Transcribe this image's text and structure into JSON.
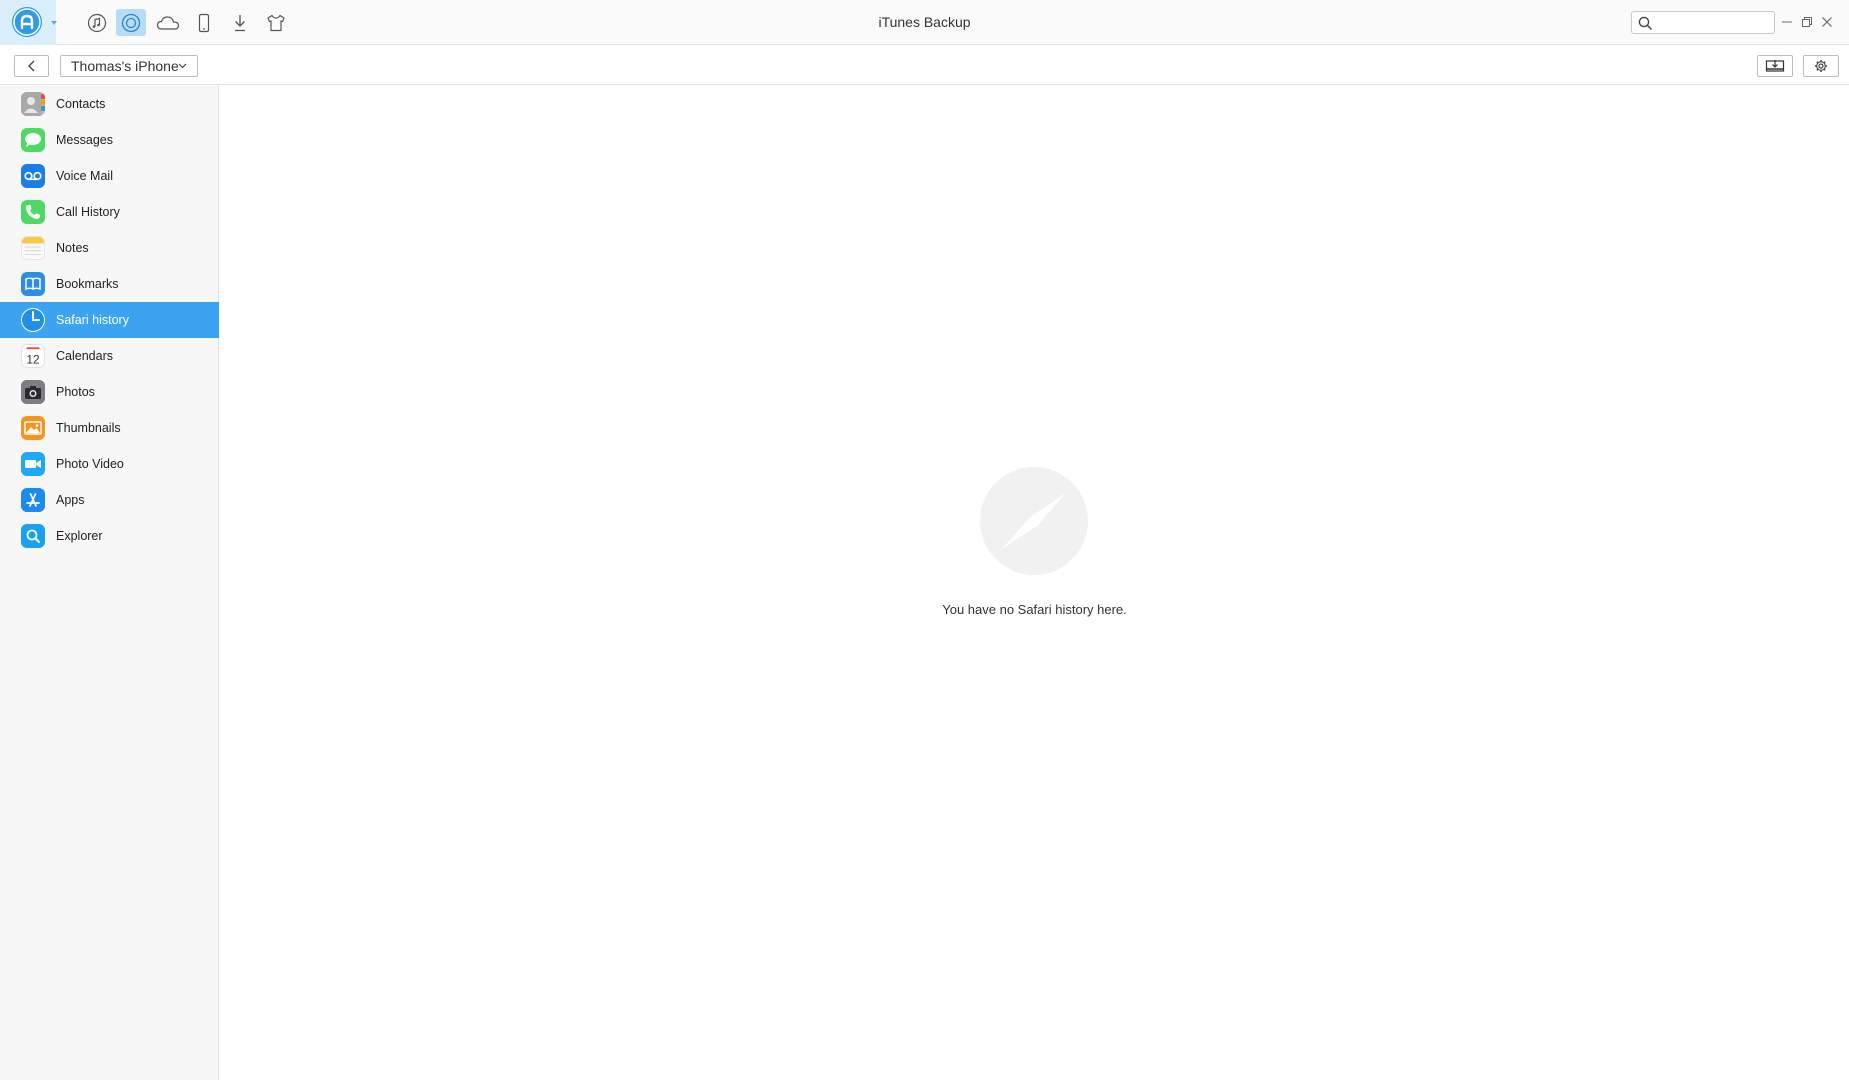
{
  "window": {
    "title": "iTunes Backup"
  },
  "top_icons": [
    {
      "name": "music-icon"
    },
    {
      "name": "itunes-backup-icon",
      "active": true
    },
    {
      "name": "icloud-icon"
    },
    {
      "name": "device-icon"
    },
    {
      "name": "download-icon"
    },
    {
      "name": "toolkit-icon"
    }
  ],
  "search": {
    "placeholder": "",
    "value": ""
  },
  "toolbar": {
    "device_name": "Thomas's iPhone"
  },
  "sidebar": {
    "items": [
      {
        "label": "Contacts",
        "icon": "contacts-icon"
      },
      {
        "label": "Messages",
        "icon": "messages-icon"
      },
      {
        "label": "Voice Mail",
        "icon": "voicemail-icon"
      },
      {
        "label": "Call History",
        "icon": "phone-icon"
      },
      {
        "label": "Notes",
        "icon": "notes-icon"
      },
      {
        "label": "Bookmarks",
        "icon": "bookmarks-icon"
      },
      {
        "label": "Safari history",
        "icon": "safari-icon",
        "selected": true
      },
      {
        "label": "Calendars",
        "icon": "calendar-icon",
        "calendar_day": "12"
      },
      {
        "label": "Photos",
        "icon": "camera-icon"
      },
      {
        "label": "Thumbnails",
        "icon": "thumbnails-icon"
      },
      {
        "label": "Photo Video",
        "icon": "video-icon"
      },
      {
        "label": "Apps",
        "icon": "app-store-icon"
      },
      {
        "label": "Explorer",
        "icon": "explorer-icon"
      }
    ]
  },
  "main": {
    "empty_message": "You have no Safari history here."
  },
  "colors": {
    "accent": "#3ba3ef",
    "active_tab": "#b7dcf6",
    "logo": "#2d9be6"
  }
}
